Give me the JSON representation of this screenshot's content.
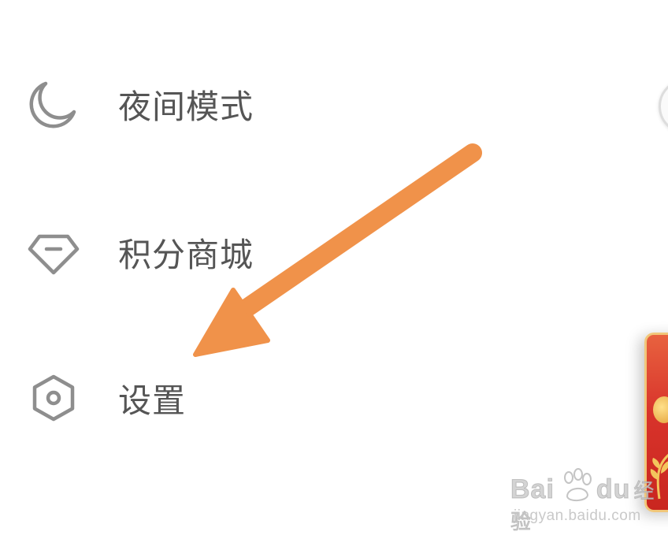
{
  "menu": {
    "items": [
      {
        "label": "夜间模式",
        "icon": "moon-icon"
      },
      {
        "label": "积分商城",
        "icon": "diamond-icon"
      },
      {
        "label": "设置",
        "icon": "hexagon-gear-icon"
      }
    ]
  },
  "annotation": {
    "arrow_color": "#F0924A",
    "arrow_target": "设置"
  },
  "colors": {
    "icon": "#8e8e8e",
    "label": "#555555",
    "background": "#ffffff",
    "red_card": "#d8332b"
  },
  "watermark": {
    "logo": "Bai du 经验",
    "url": "jingyan.baidu.com"
  }
}
